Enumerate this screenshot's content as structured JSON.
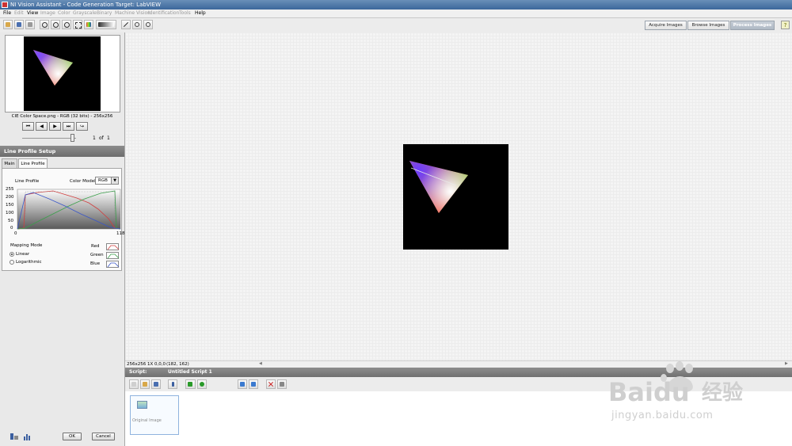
{
  "window": {
    "title": "NI Vision Assistant - Code Generation Target: LabVIEW"
  },
  "menu": [
    {
      "label": "File",
      "enabled": true
    },
    {
      "label": "Edit",
      "enabled": false
    },
    {
      "label": "View",
      "enabled": true
    },
    {
      "label": "Image",
      "enabled": false
    },
    {
      "label": "Color",
      "enabled": false
    },
    {
      "label": "Grayscale",
      "enabled": false
    },
    {
      "label": "Binary",
      "enabled": false
    },
    {
      "label": "Machine Vision",
      "enabled": false
    },
    {
      "label": "Identification",
      "enabled": false
    },
    {
      "label": "Tools",
      "enabled": false
    },
    {
      "label": "Help",
      "enabled": true
    }
  ],
  "mode_tabs": {
    "acquire": "Acquire Images",
    "browse": "Browse Images",
    "process": "Process Images",
    "active": "process",
    "help": "?"
  },
  "browser": {
    "image_label": "CIE Color Space.png - RGB (32 bits) - 256x256",
    "nav": {
      "first": "⏮",
      "prev": "◀",
      "next": "▶",
      "last": "⏭",
      "return": "↪"
    },
    "page_current": "1",
    "page_of": "of",
    "page_total": "1",
    "slider_level": 0.9
  },
  "setup": {
    "title": "Line Profile Setup",
    "tabs": [
      "Main",
      "Line Profile"
    ],
    "active_tab": "Line Profile",
    "line_profile_label": "Line Profile",
    "color_model_label": "Color Model",
    "color_model_value": "RGB",
    "graph": {
      "y_ticks": [
        "255",
        "200",
        "150",
        "100",
        "50",
        "0"
      ],
      "x_ticks": [
        "0",
        "118"
      ]
    },
    "mapping_mode_label": "Mapping Mode",
    "mapping_options": [
      "Linear",
      "Logarithmic"
    ],
    "mapping_selected": "Linear",
    "channels": [
      {
        "label": "Red",
        "color": "#d04040"
      },
      {
        "label": "Green",
        "color": "#3aa04a"
      },
      {
        "label": "Blue",
        "color": "#3a56c8"
      }
    ],
    "ok_label": "OK",
    "cancel_label": "Cancel"
  },
  "status": {
    "info": "256x256 1X 0,0,0",
    "coords": "(182, 162)"
  },
  "script": {
    "label": "Script:",
    "name": "Untitled Script 1",
    "steps": [
      {
        "label": "Original Image"
      }
    ]
  },
  "watermark": {
    "brand": "Baidu",
    "cn": "经验",
    "url": "jingyan.baidu.com"
  },
  "colors": {
    "header_gray": "#777777",
    "active_tab": "#b8c0cb",
    "canvas_bg": "#f4f4f4"
  }
}
